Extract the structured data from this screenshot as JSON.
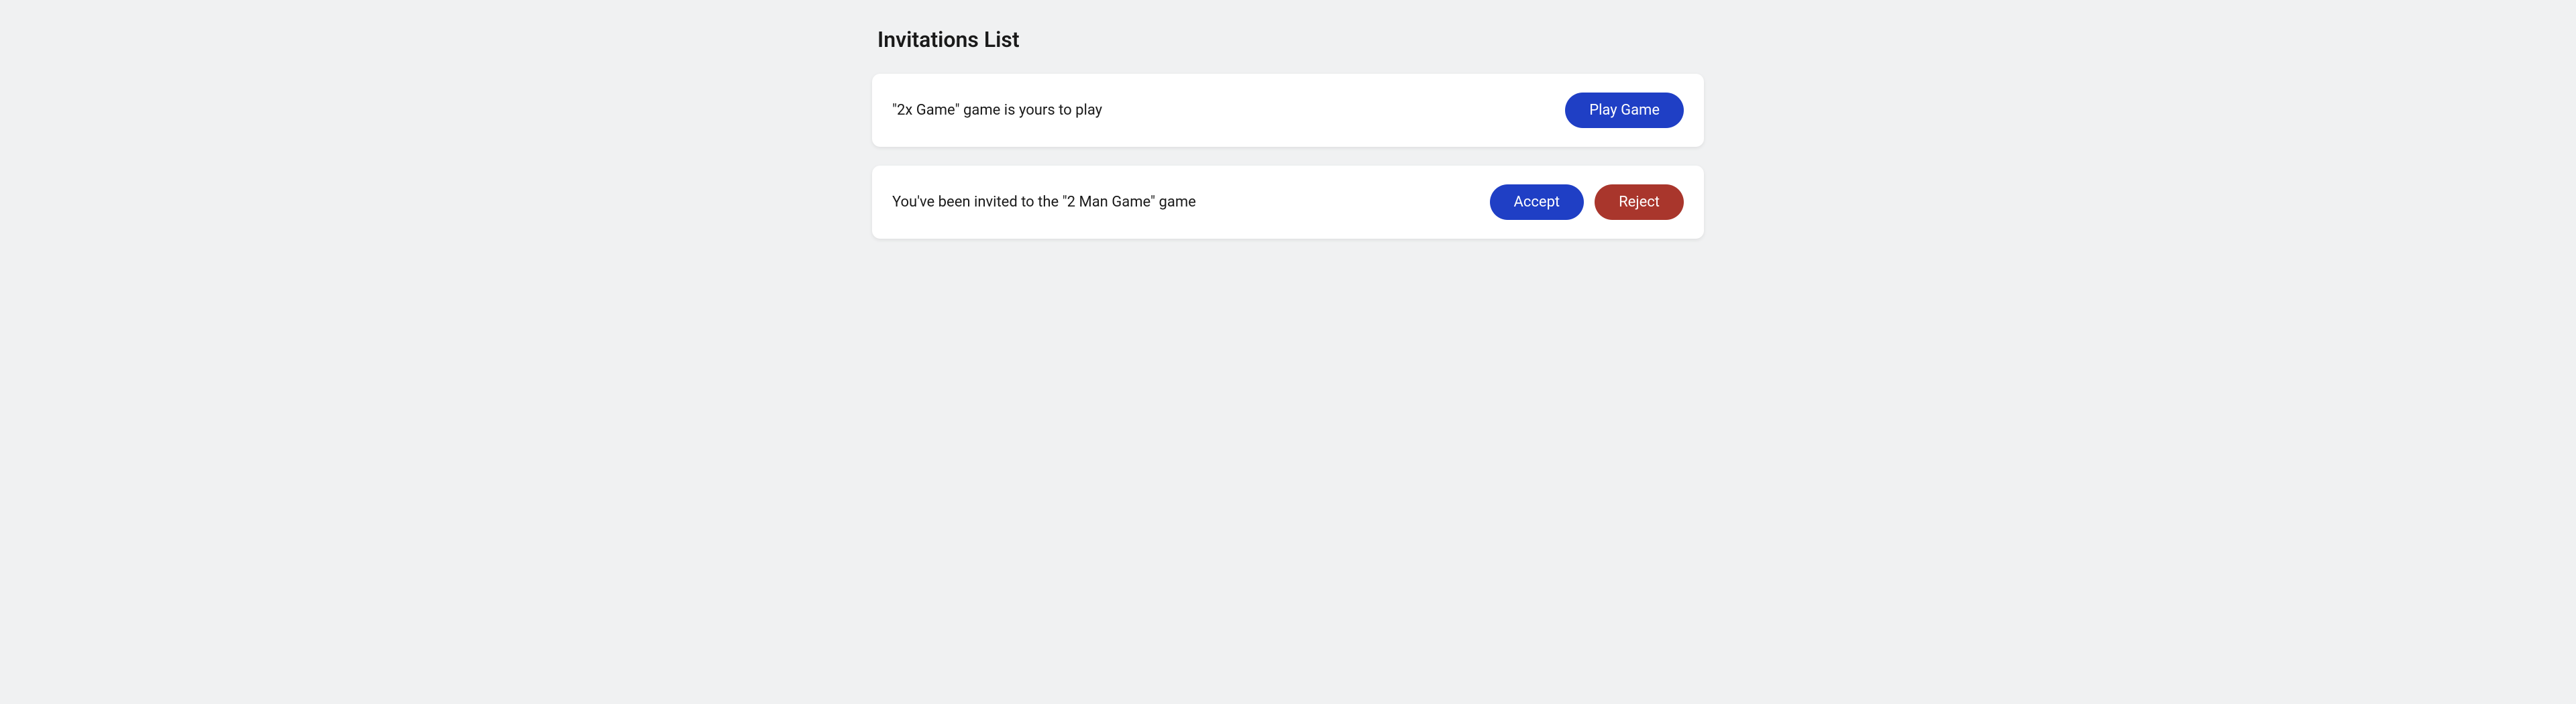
{
  "page": {
    "title": "Invitations List"
  },
  "invitations": [
    {
      "message": "\"2x Game\" game is yours to play",
      "actions": {
        "play": "Play Game"
      }
    },
    {
      "message": "You've been invited to the \"2 Man Game\" game",
      "actions": {
        "accept": "Accept",
        "reject": "Reject"
      }
    }
  ]
}
